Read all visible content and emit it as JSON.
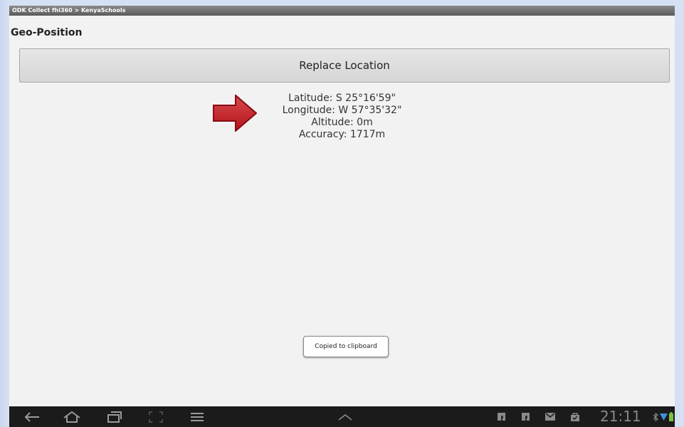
{
  "window": {
    "title": "ODK Collect fhi360 > KenyaSchools"
  },
  "form": {
    "question_label": "Geo-Position",
    "replace_button_label": "Replace Location",
    "location": {
      "latitude": "Latitude: S 25°16'59\"",
      "longitude": "Longitude: W 57°35'32\"",
      "altitude": "Altitude: 0m",
      "accuracy": "Accuracy: 1717m"
    },
    "annotation_arrow_color": "#c0161b"
  },
  "toast": {
    "message": "Copied to clipboard"
  },
  "system_bar": {
    "nav_icons": [
      "back-icon",
      "home-icon",
      "recent-apps-icon",
      "screenshot-icon",
      "menu-icon",
      "chevron-up-icon"
    ],
    "status_icons": [
      "facebook-icon",
      "facebook-icon",
      "gmail-icon",
      "market-icon",
      "bluetooth-icon",
      "wifi-icon",
      "battery-icon"
    ],
    "time": "21:11"
  }
}
